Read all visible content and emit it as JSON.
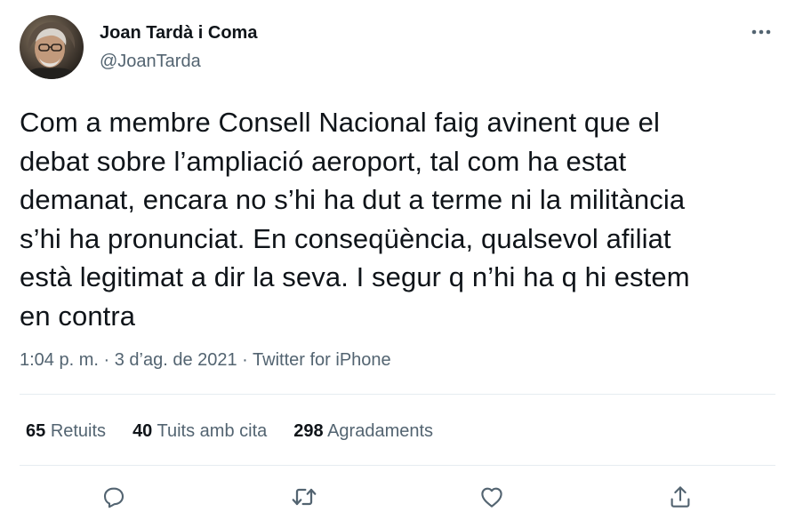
{
  "author": {
    "display_name": "Joan Tardà i Coma",
    "handle": "@JoanTarda",
    "avatar_icon": "profile-photo"
  },
  "more_icon": "ellipsis-icon",
  "tweet": {
    "lines": [
      "Com a membre Consell Nacional faig avinent que el",
      "debat sobre l’ampliació aeroport, tal com ha estat",
      "demanat, encara no s’hi ha dut a terme ni la militància",
      "s’hi ha pronunciat. En conseqüència, qualsevol afiliat",
      "està legitimat a dir la seva. I segur q n’hi ha q hi estem",
      "en contra"
    ]
  },
  "meta": {
    "time": "1:04 p. m.",
    "separator": " · ",
    "date": "3 d’ag. de 2021",
    "source": "Twitter for iPhone"
  },
  "stats": {
    "retweets": {
      "count": "65",
      "label": "Retuits"
    },
    "quotes": {
      "count": "40",
      "label": "Tuits amb cita"
    },
    "likes": {
      "count": "298",
      "label": "Agradaments"
    }
  },
  "actions": [
    "reply-icon",
    "retweet-icon",
    "like-icon",
    "share-icon"
  ],
  "colors": {
    "text": "#0f1419",
    "secondary": "#536471",
    "divider": "#e6ecf0"
  }
}
